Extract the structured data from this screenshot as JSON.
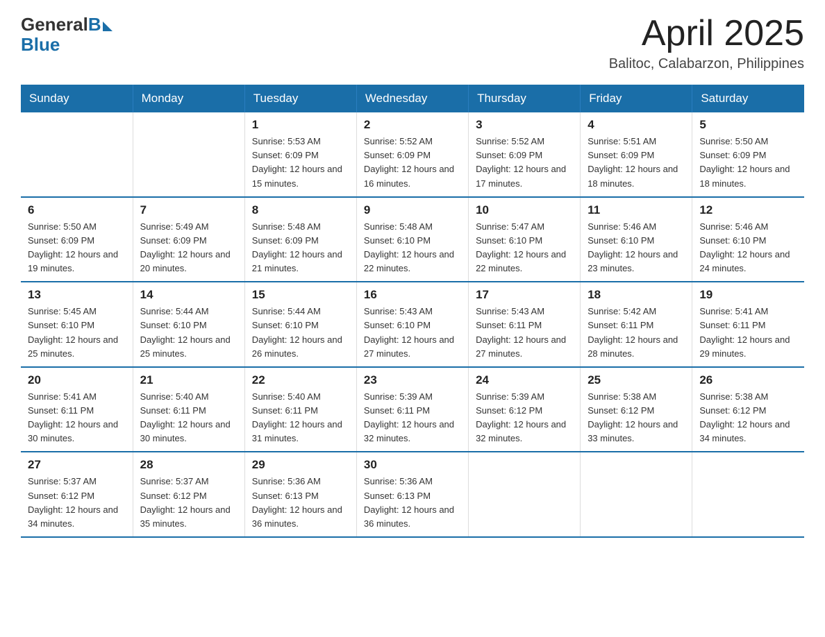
{
  "header": {
    "logo": {
      "general": "General",
      "blue": "Blue"
    },
    "title": "April 2025",
    "location": "Balitoc, Calabarzon, Philippines"
  },
  "days_of_week": [
    "Sunday",
    "Monday",
    "Tuesday",
    "Wednesday",
    "Thursday",
    "Friday",
    "Saturday"
  ],
  "weeks": [
    [
      {
        "day": "",
        "sunrise": "",
        "sunset": "",
        "daylight": ""
      },
      {
        "day": "",
        "sunrise": "",
        "sunset": "",
        "daylight": ""
      },
      {
        "day": "1",
        "sunrise": "Sunrise: 5:53 AM",
        "sunset": "Sunset: 6:09 PM",
        "daylight": "Daylight: 12 hours and 15 minutes."
      },
      {
        "day": "2",
        "sunrise": "Sunrise: 5:52 AM",
        "sunset": "Sunset: 6:09 PM",
        "daylight": "Daylight: 12 hours and 16 minutes."
      },
      {
        "day": "3",
        "sunrise": "Sunrise: 5:52 AM",
        "sunset": "Sunset: 6:09 PM",
        "daylight": "Daylight: 12 hours and 17 minutes."
      },
      {
        "day": "4",
        "sunrise": "Sunrise: 5:51 AM",
        "sunset": "Sunset: 6:09 PM",
        "daylight": "Daylight: 12 hours and 18 minutes."
      },
      {
        "day": "5",
        "sunrise": "Sunrise: 5:50 AM",
        "sunset": "Sunset: 6:09 PM",
        "daylight": "Daylight: 12 hours and 18 minutes."
      }
    ],
    [
      {
        "day": "6",
        "sunrise": "Sunrise: 5:50 AM",
        "sunset": "Sunset: 6:09 PM",
        "daylight": "Daylight: 12 hours and 19 minutes."
      },
      {
        "day": "7",
        "sunrise": "Sunrise: 5:49 AM",
        "sunset": "Sunset: 6:09 PM",
        "daylight": "Daylight: 12 hours and 20 minutes."
      },
      {
        "day": "8",
        "sunrise": "Sunrise: 5:48 AM",
        "sunset": "Sunset: 6:09 PM",
        "daylight": "Daylight: 12 hours and 21 minutes."
      },
      {
        "day": "9",
        "sunrise": "Sunrise: 5:48 AM",
        "sunset": "Sunset: 6:10 PM",
        "daylight": "Daylight: 12 hours and 22 minutes."
      },
      {
        "day": "10",
        "sunrise": "Sunrise: 5:47 AM",
        "sunset": "Sunset: 6:10 PM",
        "daylight": "Daylight: 12 hours and 22 minutes."
      },
      {
        "day": "11",
        "sunrise": "Sunrise: 5:46 AM",
        "sunset": "Sunset: 6:10 PM",
        "daylight": "Daylight: 12 hours and 23 minutes."
      },
      {
        "day": "12",
        "sunrise": "Sunrise: 5:46 AM",
        "sunset": "Sunset: 6:10 PM",
        "daylight": "Daylight: 12 hours and 24 minutes."
      }
    ],
    [
      {
        "day": "13",
        "sunrise": "Sunrise: 5:45 AM",
        "sunset": "Sunset: 6:10 PM",
        "daylight": "Daylight: 12 hours and 25 minutes."
      },
      {
        "day": "14",
        "sunrise": "Sunrise: 5:44 AM",
        "sunset": "Sunset: 6:10 PM",
        "daylight": "Daylight: 12 hours and 25 minutes."
      },
      {
        "day": "15",
        "sunrise": "Sunrise: 5:44 AM",
        "sunset": "Sunset: 6:10 PM",
        "daylight": "Daylight: 12 hours and 26 minutes."
      },
      {
        "day": "16",
        "sunrise": "Sunrise: 5:43 AM",
        "sunset": "Sunset: 6:10 PM",
        "daylight": "Daylight: 12 hours and 27 minutes."
      },
      {
        "day": "17",
        "sunrise": "Sunrise: 5:43 AM",
        "sunset": "Sunset: 6:11 PM",
        "daylight": "Daylight: 12 hours and 27 minutes."
      },
      {
        "day": "18",
        "sunrise": "Sunrise: 5:42 AM",
        "sunset": "Sunset: 6:11 PM",
        "daylight": "Daylight: 12 hours and 28 minutes."
      },
      {
        "day": "19",
        "sunrise": "Sunrise: 5:41 AM",
        "sunset": "Sunset: 6:11 PM",
        "daylight": "Daylight: 12 hours and 29 minutes."
      }
    ],
    [
      {
        "day": "20",
        "sunrise": "Sunrise: 5:41 AM",
        "sunset": "Sunset: 6:11 PM",
        "daylight": "Daylight: 12 hours and 30 minutes."
      },
      {
        "day": "21",
        "sunrise": "Sunrise: 5:40 AM",
        "sunset": "Sunset: 6:11 PM",
        "daylight": "Daylight: 12 hours and 30 minutes."
      },
      {
        "day": "22",
        "sunrise": "Sunrise: 5:40 AM",
        "sunset": "Sunset: 6:11 PM",
        "daylight": "Daylight: 12 hours and 31 minutes."
      },
      {
        "day": "23",
        "sunrise": "Sunrise: 5:39 AM",
        "sunset": "Sunset: 6:11 PM",
        "daylight": "Daylight: 12 hours and 32 minutes."
      },
      {
        "day": "24",
        "sunrise": "Sunrise: 5:39 AM",
        "sunset": "Sunset: 6:12 PM",
        "daylight": "Daylight: 12 hours and 32 minutes."
      },
      {
        "day": "25",
        "sunrise": "Sunrise: 5:38 AM",
        "sunset": "Sunset: 6:12 PM",
        "daylight": "Daylight: 12 hours and 33 minutes."
      },
      {
        "day": "26",
        "sunrise": "Sunrise: 5:38 AM",
        "sunset": "Sunset: 6:12 PM",
        "daylight": "Daylight: 12 hours and 34 minutes."
      }
    ],
    [
      {
        "day": "27",
        "sunrise": "Sunrise: 5:37 AM",
        "sunset": "Sunset: 6:12 PM",
        "daylight": "Daylight: 12 hours and 34 minutes."
      },
      {
        "day": "28",
        "sunrise": "Sunrise: 5:37 AM",
        "sunset": "Sunset: 6:12 PM",
        "daylight": "Daylight: 12 hours and 35 minutes."
      },
      {
        "day": "29",
        "sunrise": "Sunrise: 5:36 AM",
        "sunset": "Sunset: 6:13 PM",
        "daylight": "Daylight: 12 hours and 36 minutes."
      },
      {
        "day": "30",
        "sunrise": "Sunrise: 5:36 AM",
        "sunset": "Sunset: 6:13 PM",
        "daylight": "Daylight: 12 hours and 36 minutes."
      },
      {
        "day": "",
        "sunrise": "",
        "sunset": "",
        "daylight": ""
      },
      {
        "day": "",
        "sunrise": "",
        "sunset": "",
        "daylight": ""
      },
      {
        "day": "",
        "sunrise": "",
        "sunset": "",
        "daylight": ""
      }
    ]
  ]
}
